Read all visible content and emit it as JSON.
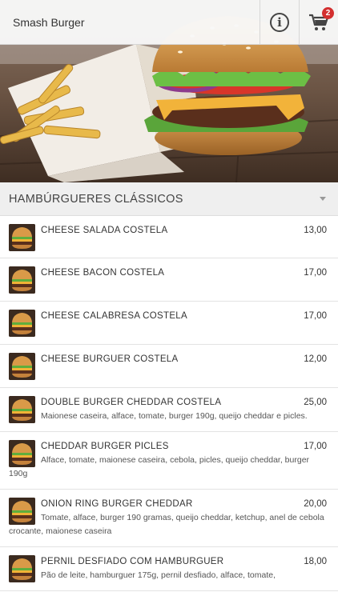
{
  "header": {
    "title": "Smash Burger",
    "cart_count": "2"
  },
  "category": {
    "title": "HAMBÚRGUERES CLÁSSICOS"
  },
  "items": [
    {
      "name": "CHEESE SALADA COSTELA",
      "price": "13,00",
      "desc": ""
    },
    {
      "name": "CHEESE BACON COSTELA",
      "price": "17,00",
      "desc": ""
    },
    {
      "name": "CHEESE CALABRESA COSTELA",
      "price": "17,00",
      "desc": ""
    },
    {
      "name": "CHEESE BURGUER COSTELA",
      "price": "12,00",
      "desc": ""
    },
    {
      "name": "DOUBLE BURGER CHEDDAR COSTELA",
      "price": "25,00",
      "desc": "Maionese caseira, alface, tomate, burger 190g, queijo cheddar e picles."
    },
    {
      "name": "CHEDDAR BURGER PICLES",
      "price": "17,00",
      "desc": "Alface, tomate, maionese caseira, cebola, picles, queijo cheddar, burger 190g"
    },
    {
      "name": "ONION RING BURGER CHEDDAR",
      "price": "20,00",
      "desc": "Tomate, alface, burger 190 gramas, queijo cheddar, ketchup, anel de cebola crocante, maionese caseira"
    },
    {
      "name": "PERNIL DESFIADO COM HAMBURGUER",
      "price": "18,00",
      "desc": "Pão de leite, hamburguer 175g, pernil desfiado, alface, tomate,"
    }
  ],
  "icons": {
    "info": "info-icon",
    "cart": "cart-icon"
  },
  "colors": {
    "badge": "#d32f2f",
    "header_bg": "#f8f8f8",
    "category_bg": "#efefef"
  }
}
